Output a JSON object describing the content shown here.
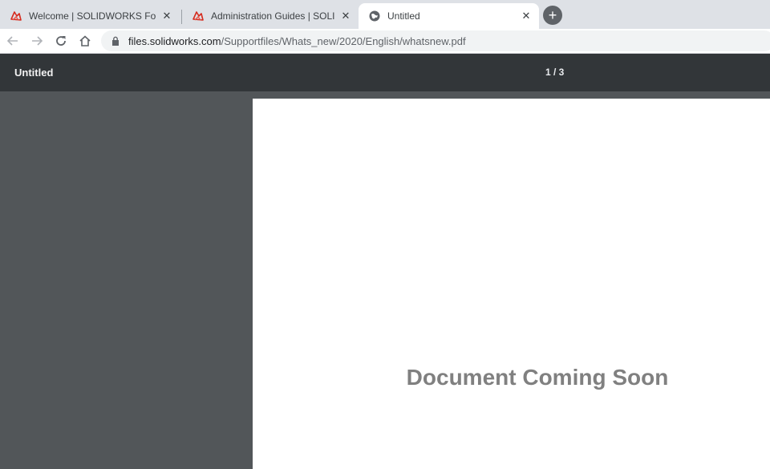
{
  "tabs": [
    {
      "title": "Welcome | SOLIDWORKS Forums",
      "favicon": "solidworks-logo-icon",
      "active": false
    },
    {
      "title": "Administration Guides | SOLIDWORKS",
      "favicon": "solidworks-logo-icon",
      "active": false
    },
    {
      "title": "Untitled",
      "favicon": "globe-icon",
      "active": true
    }
  ],
  "close_glyph": "✕",
  "new_tab_glyph": "+",
  "address_bar": {
    "host": "files.solidworks.com",
    "path": "/Supportfiles/Whats_new/2020/English/whatsnew.pdf"
  },
  "pdf_viewer": {
    "title": "Untitled",
    "page_indicator": "1 / 3",
    "page_text": "Document Coming Soon"
  },
  "colors": {
    "solidworks_red": "#d52b1e",
    "toolbar_dark": "#323639",
    "viewer_bg": "#525659"
  }
}
